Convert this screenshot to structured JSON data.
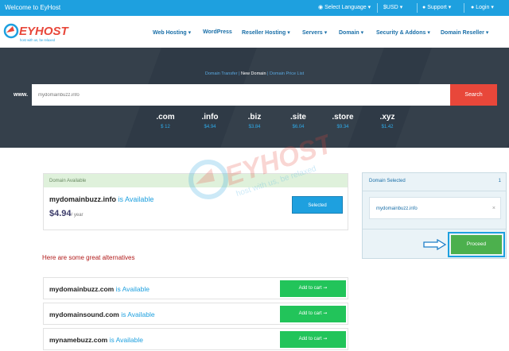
{
  "topbar": {
    "welcome": "Welcome to EyHost",
    "language": "Select Language",
    "currency": "$USD",
    "support": "Support",
    "login": "Login"
  },
  "logo": {
    "brand": "EYHOST",
    "tagline": "host with us, be relaxed"
  },
  "nav": [
    "Web Hosting",
    "WordPress",
    "Reseller Hosting",
    "Servers",
    "Domain",
    "Security & Addons",
    "Domain Reseller"
  ],
  "hero": {
    "links": {
      "transfer": "Domain Transfer",
      "new": "New Domain",
      "pricelist": "Domain Price List",
      "sep": "|"
    },
    "www": "www.",
    "search_value": "mydomainbuzz.info",
    "search_button": "Search",
    "tlds": [
      {
        "ext": ".com",
        "price": "$ 12"
      },
      {
        "ext": ".info",
        "price": "$4.94"
      },
      {
        "ext": ".biz",
        "price": "$3.84"
      },
      {
        "ext": ".site",
        "price": "$6.04"
      },
      {
        "ext": ".store",
        "price": "$9.34"
      },
      {
        "ext": ".xyz",
        "price": "$1.42"
      }
    ]
  },
  "available": {
    "header": "Domain Available",
    "domain": "mydomainbuzz.info",
    "is_available": "is Available",
    "price": "$4.94",
    "per": "/ year",
    "button": "Selected"
  },
  "selected_panel": {
    "header": "Domain Selected",
    "count": "1",
    "item": "mydomainbuzz.info",
    "remove": "×",
    "proceed": "Proceed"
  },
  "alternatives": {
    "title": "Here are some great alternatives",
    "is_available": "is Available",
    "button": "Add to cart",
    "items": [
      "mydomainbuzz.com",
      "mydomainsound.com",
      "mynamebuzz.com"
    ]
  },
  "colors": {
    "primary": "#1ea0df",
    "search": "#e8473a",
    "add": "#22c45a",
    "proceed": "#4cb04d",
    "alt_title": "#b11b1b"
  }
}
